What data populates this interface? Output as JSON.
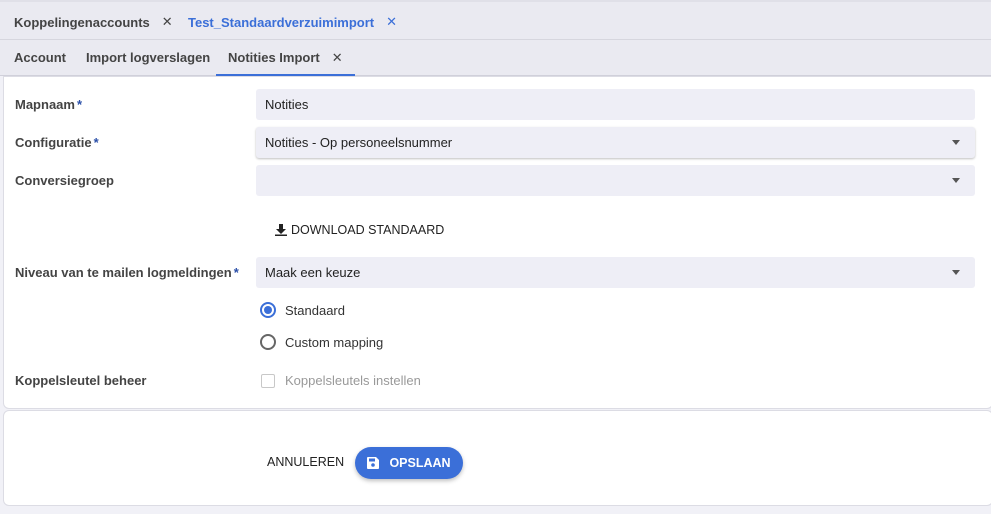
{
  "top_tabs": [
    {
      "label": "Koppelingenaccounts",
      "close": "✕"
    },
    {
      "label": "Test_Standaardverzuimimport",
      "close": "✕"
    }
  ],
  "sub_tabs": [
    {
      "label": "Account"
    },
    {
      "label": "Import logverslagen"
    },
    {
      "label": "Notities Import",
      "close": "✕"
    }
  ],
  "form": {
    "mapnaam": {
      "label": "Mapnaam",
      "required": "*",
      "value": "Notities"
    },
    "configuratie": {
      "label": "Configuratie",
      "required": "*",
      "value": "Notities - Op personeelsnummer"
    },
    "conversiegroep": {
      "label": "Conversiegroep",
      "value": ""
    },
    "download_label": "DOWNLOAD STANDAARD",
    "niveau": {
      "label": "Niveau van te mailen logmeldingen",
      "required": "*",
      "value": "Maak een keuze"
    },
    "radio_standaard": "Standaard",
    "radio_custom": "Custom mapping",
    "koppelsleutel": {
      "label": "Koppelsleutel beheer",
      "checkbox_label": "Koppelsleutels instellen"
    }
  },
  "actions": {
    "cancel": "ANNULEREN",
    "save": "OPSLAAN"
  },
  "colors": {
    "accent": "#3b6fd8"
  }
}
